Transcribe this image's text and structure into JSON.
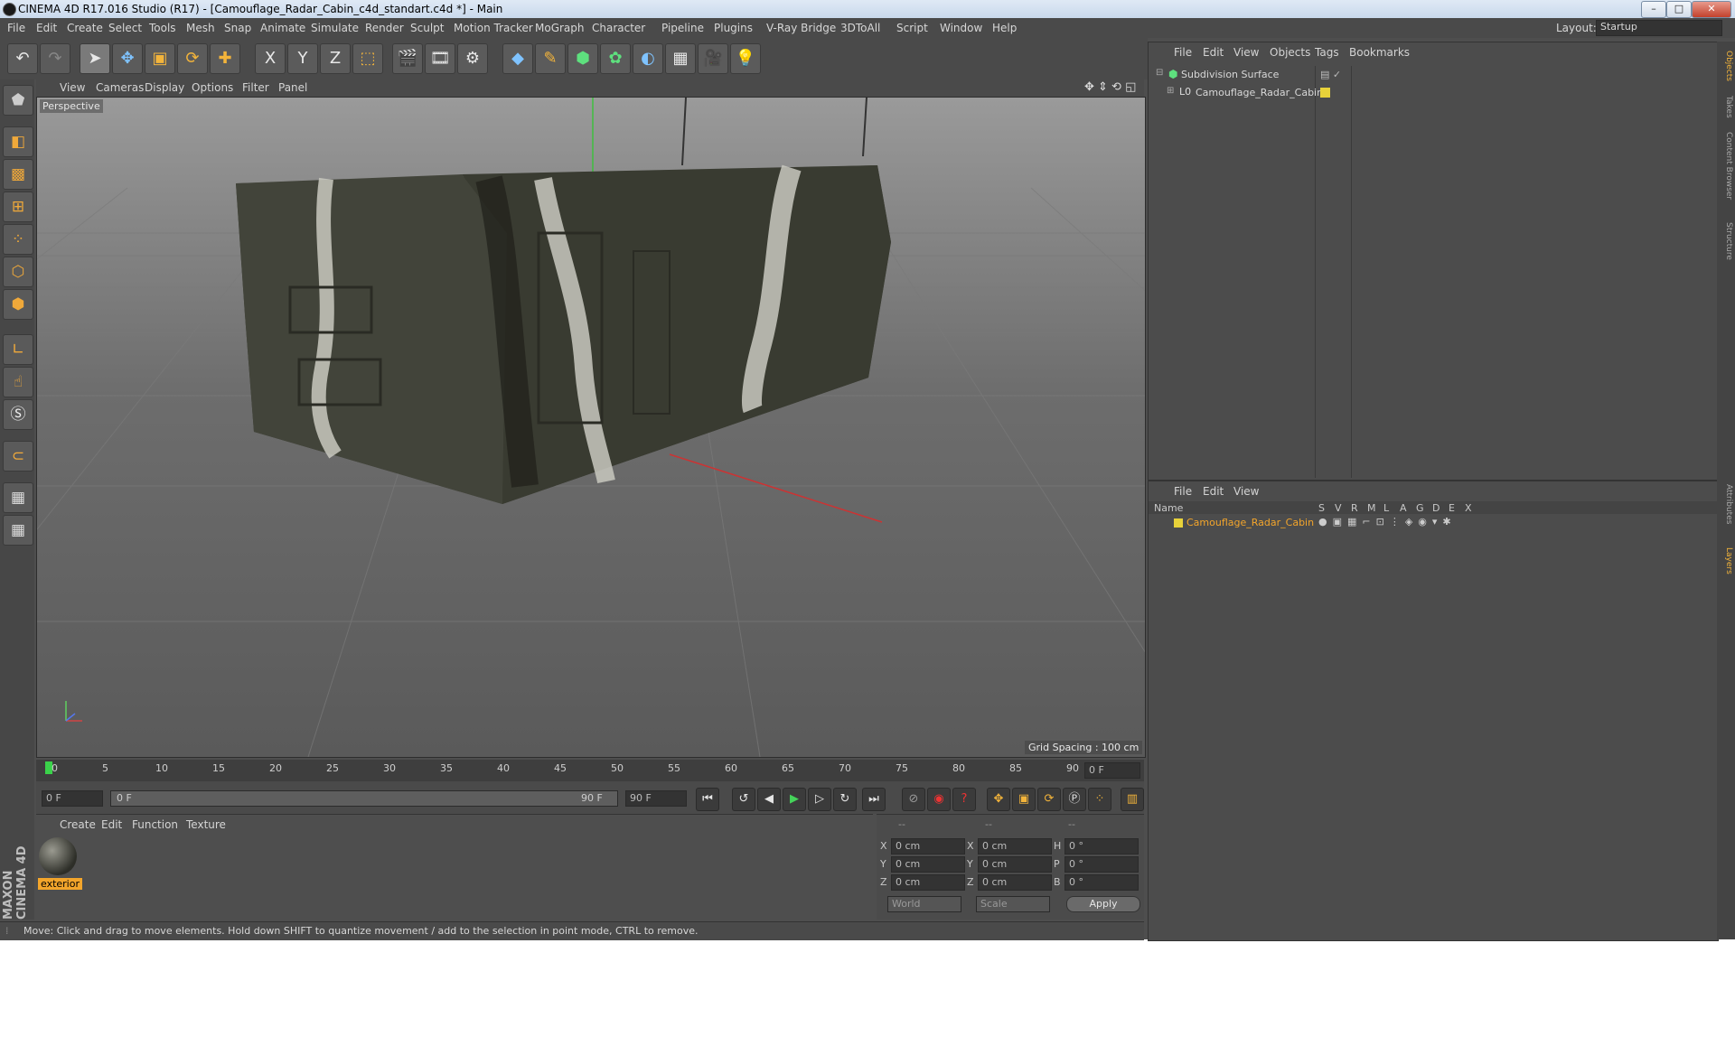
{
  "window": {
    "title": "CINEMA 4D R17.016 Studio (R17) - [Camouflage_Radar_Cabin_c4d_standart.c4d *] - Main",
    "minimize": "–",
    "maximize": "□",
    "close": "✕"
  },
  "menubar": {
    "items": [
      "File",
      "Edit",
      "Create",
      "Select",
      "Tools",
      "Mesh",
      "Snap",
      "Animate",
      "Simulate",
      "Render",
      "Sculpt",
      "Motion Tracker",
      "MoGraph",
      "Character",
      "Pipeline",
      "Plugins",
      "V-Ray Bridge",
      "3DToAll",
      "Script",
      "Window",
      "Help"
    ],
    "layout_label": "Layout:",
    "layout_value": "Startup"
  },
  "toolbar": {
    "axis_x": "X",
    "axis_y": "Y",
    "axis_z": "Z"
  },
  "viewport": {
    "menu": [
      "View",
      "Cameras",
      "Display",
      "Options",
      "Filter",
      "Panel"
    ],
    "label": "Perspective",
    "grid_spacing": "Grid Spacing : 100 cm"
  },
  "timeline": {
    "ticks": [
      "0",
      "5",
      "10",
      "15",
      "20",
      "25",
      "30",
      "35",
      "40",
      "45",
      "50",
      "55",
      "60",
      "65",
      "70",
      "75",
      "80",
      "85",
      "90"
    ],
    "current_frame": "0 F",
    "start_field": "0 F",
    "range_start": "0 F",
    "range_end": "90 F",
    "end_field": "90 F"
  },
  "material_panel": {
    "menu": [
      "Create",
      "Edit",
      "Function",
      "Texture"
    ],
    "material_name": "exterior"
  },
  "coord_panel": {
    "headers": [
      "--",
      "--",
      "--"
    ],
    "rows": [
      {
        "a": "X",
        "av": "0 cm",
        "b": "X",
        "bv": "0 cm",
        "c": "H",
        "cv": "0 °"
      },
      {
        "a": "Y",
        "av": "0 cm",
        "b": "Y",
        "bv": "0 cm",
        "c": "P",
        "cv": "0 °"
      },
      {
        "a": "Z",
        "av": "0 cm",
        "b": "Z",
        "bv": "0 cm",
        "c": "B",
        "cv": "0 °"
      }
    ],
    "world": "World",
    "scale": "Scale",
    "apply": "Apply"
  },
  "object_manager": {
    "menu": [
      "File",
      "Edit",
      "View",
      "Objects",
      "Tags",
      "Bookmarks"
    ],
    "objects": [
      "Subdivision Surface",
      "Camouflage_Radar_Cabin"
    ]
  },
  "layer_manager": {
    "menu": [
      "File",
      "Edit",
      "View"
    ],
    "col_name": "Name",
    "cols": [
      "S",
      "V",
      "R",
      "M",
      "L",
      "A",
      "G",
      "D",
      "E",
      "X"
    ],
    "layer_name": "Camouflage_Radar_Cabin"
  },
  "side_tabs": [
    "Objects",
    "Takes",
    "Content Browser",
    "Structure",
    "Attributes",
    "Layers"
  ],
  "brand": "MAXON CINEMA 4D",
  "status": "Move: Click and drag to move elements. Hold down SHIFT to quantize movement / add to the selection in point mode, CTRL to remove."
}
